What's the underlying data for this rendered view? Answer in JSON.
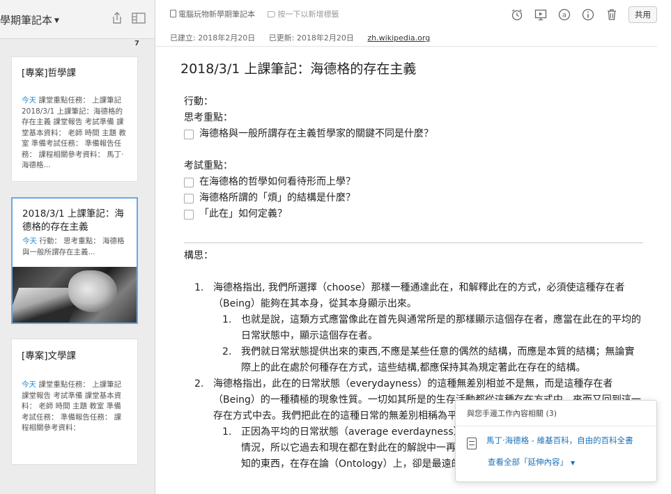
{
  "sidebar": {
    "notebook_title": "學期筆記本",
    "note_count": "7",
    "cards": [
      {
        "title": "[專案]哲學課",
        "today": "今天",
        "snippet": " 課堂重點任務： 上課筆記 2018/3/1 上課筆記：海德格的存在主義 課堂報告 考試準備 課堂基本資料： 老師 時間 主題 教室 準備考試任務： 準備報告任務： 課程相關參考資料： 馬丁·海德格..."
      },
      {
        "title": "2018/3/1 上課筆記：海德格的存在主義",
        "today": "今天",
        "snippet": " 行動： 思考重點： 海德格與一般所謂存在主義..."
      },
      {
        "title": "[專案]文學課",
        "today": "今天",
        "snippet": " 課堂重點任務： 上課筆記 課堂報告 考試準備 課堂基本資料： 老師 時間 主題 教室 準備考試任務： 準備報告任務： 課程相關參考資料："
      }
    ]
  },
  "editor": {
    "notebook_name": "電腦玩物新學期筆記本",
    "tag_hint": "按一下以新增標籤",
    "share_label": "共用",
    "created": "已建立: 2018年2月20日",
    "updated": "已更新: 2018年2月20日",
    "source": "zh.wikipedia.org",
    "title": "2018/3/1 上課筆記：海德格的存在主義",
    "action_label": "行動：",
    "thinking_label": "思考重點：",
    "thinking_items": [
      "海德格與一般所謂存在主義哲學家的關鍵不同是什麼？"
    ],
    "exam_label": "考試重點：",
    "exam_items": [
      "在海德格的哲學如何看待形而上學？",
      "海德格所謂的「煩」的結構是什麼？",
      "「此在」如何定義？"
    ],
    "idea_label": "構思：",
    "ideas": [
      {
        "num": "1.",
        "text": "海德格指出, 我們所選擇（choose）那樣一種通達此在，和解釋此在的方式，必須使這種存在者（Being）能夠在其本身，從其本身顯示出來。",
        "subs": [
          {
            "num": "1.",
            "text": "也就是說，這類方式應當像此在首先與通常所是的那樣顯示這個存在者，應當在此在的平均的日常狀態中，顯示這個存在者。"
          },
          {
            "num": "2.",
            "text": "我們就日常狀態提供出來的東西,不應是某些任意的偶然的結構，而應是本質的結構；無論實際上的此在處於何種存在方式，這些結構,都應保持其為規定著此在存在的結構。"
          }
        ]
      },
      {
        "num": "2.",
        "text": "海德格指出，此在的日常狀態（everydayness）的這種無差別相並不是無，而是這種存在者（Being）的一種積極的現象性質。一切如其所是的生存活動都從這種存在方式中，來而又回到這一存在方式中去。我們把此在的這種日常的無差別相稱為平均狀態。（Averageness）。",
        "subs": [
          {
            "num": "1.",
            "text": "正因為平均的日常狀態（average everdayness）構成了這種存在者在存在者層次上的當下情況，所以它過去和現在都在對此在的解說中一再被跳過了。這種存在者層次上最近的和最熟知的東西，在存在論（Ontology）上，卻是最遠的、和不為人知的。"
          }
        ]
      }
    ]
  },
  "related": {
    "header": "與您手邊工作內容相關 (3)",
    "item_title": "馬丁·海德格 - 維基百科，自由的百科全書",
    "more": "查看全部「延伸內容」"
  },
  "icons": {
    "share": "share-icon",
    "layout": "layout-icon",
    "reminder": "alarm-icon",
    "present": "present-icon",
    "mention": "at-icon",
    "info": "info-icon",
    "trash": "trash-icon",
    "notebook": "notebook-icon",
    "tag": "tag-icon",
    "document": "document-icon"
  }
}
